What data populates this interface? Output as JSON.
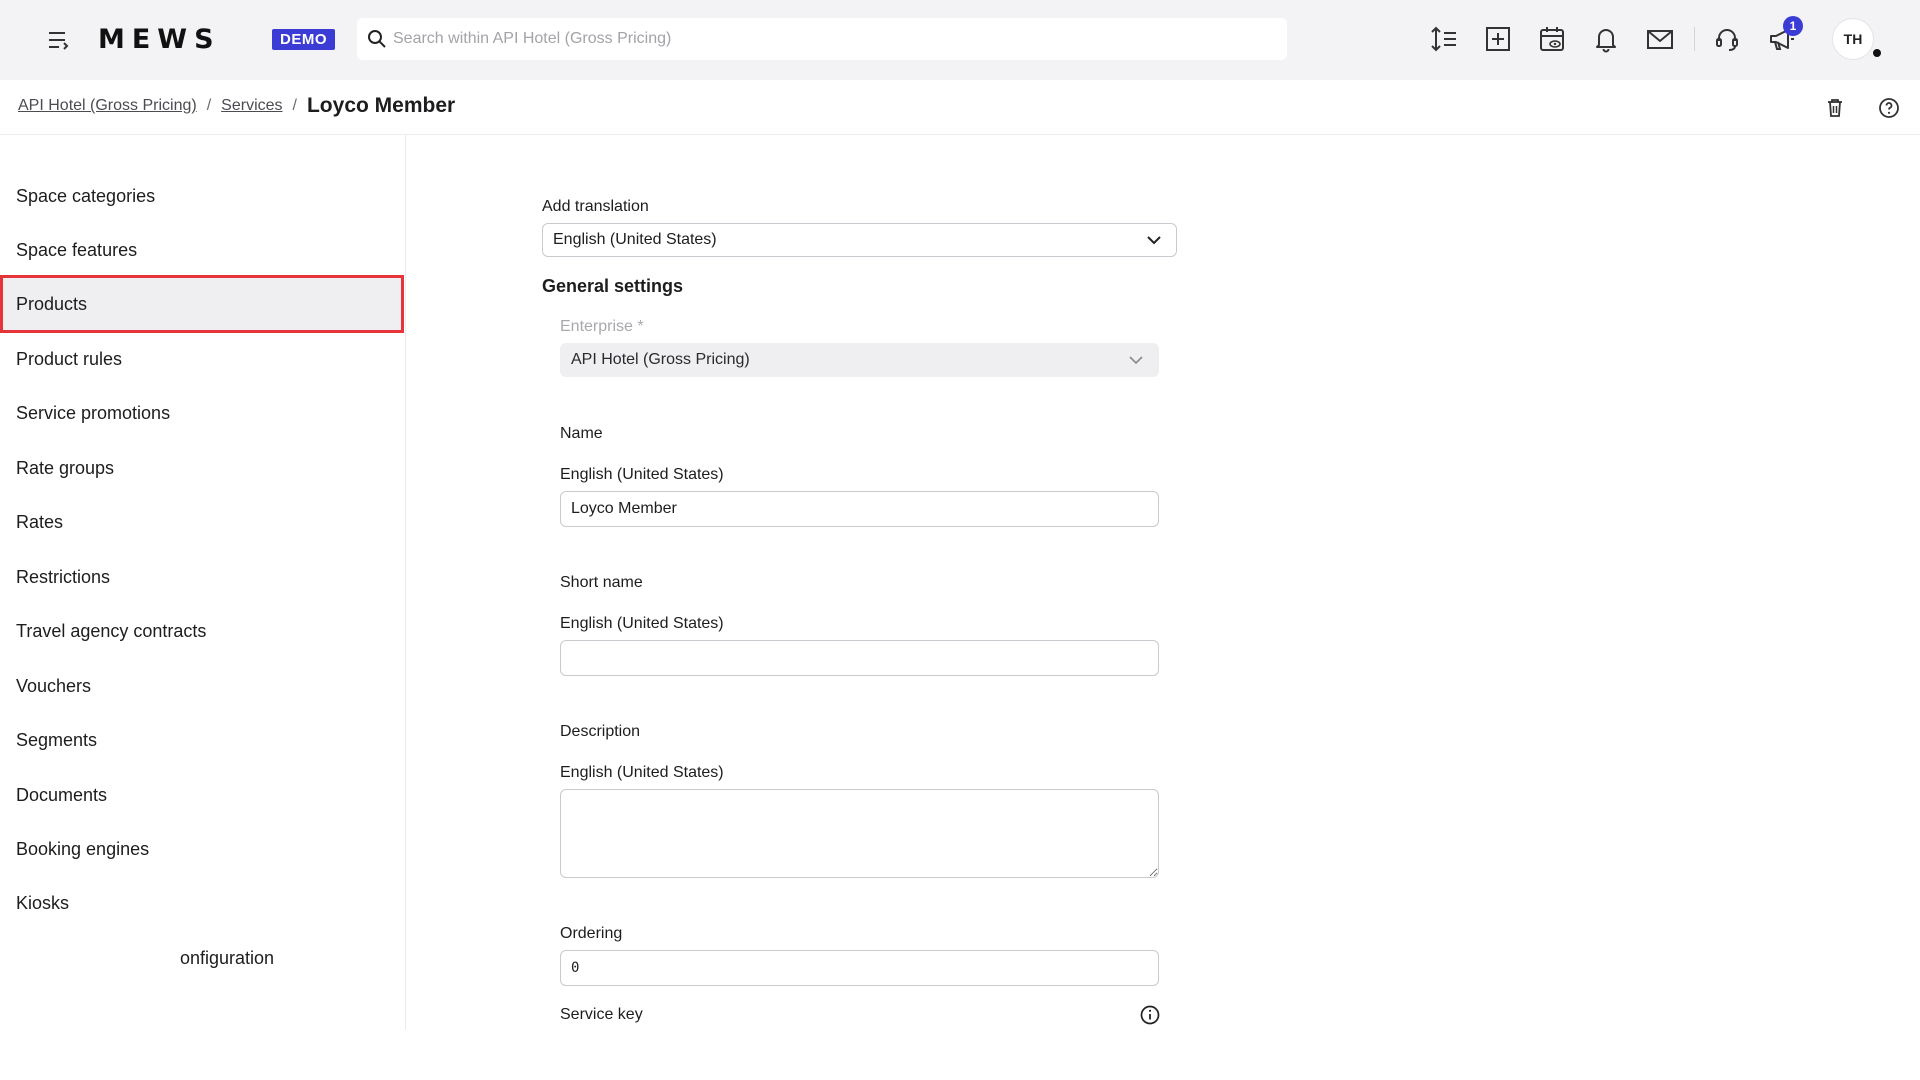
{
  "topbar": {
    "logo": "MEWS",
    "demo_badge": "DEMO",
    "search_placeholder": "Search within API Hotel (Gross Pricing)",
    "notification_count": "1",
    "avatar_initials": "TH"
  },
  "breadcrumb": {
    "items": [
      "API Hotel (Gross Pricing)",
      "Services"
    ],
    "separator": "/",
    "current": "Loyco Member"
  },
  "sidebar": {
    "items": [
      {
        "label": "Space categories"
      },
      {
        "label": "Space features"
      },
      {
        "label": "Products",
        "active": true
      },
      {
        "label": "Product rules"
      },
      {
        "label": "Service promotions"
      },
      {
        "label": "Rate groups"
      },
      {
        "label": "Rates"
      },
      {
        "label": "Restrictions"
      },
      {
        "label": "Travel agency contracts"
      },
      {
        "label": "Vouchers"
      },
      {
        "label": "Segments"
      },
      {
        "label": "Documents"
      },
      {
        "label": "Booking engines"
      },
      {
        "label": "Kiosks"
      },
      {
        "label": "onfiguration"
      }
    ]
  },
  "form": {
    "add_translation_label": "Add translation",
    "add_translation_value": "English (United States)",
    "general_settings_heading": "General settings",
    "enterprise_label": "Enterprise *",
    "enterprise_value": "API Hotel (Gross Pricing)",
    "name_label": "Name",
    "name_lang_label": "English (United States)",
    "name_value": "Loyco Member",
    "short_name_label": "Short name",
    "short_name_lang_label": "English (United States)",
    "short_name_value": "",
    "description_label": "Description",
    "description_lang_label": "English (United States)",
    "description_value": "",
    "ordering_label": "Ordering",
    "ordering_value": "0",
    "service_key_label": "Service key"
  },
  "colors": {
    "accent": "#3b3bd6",
    "active_outline": "#e5343a",
    "topbar_bg": "#f3f3f5"
  }
}
